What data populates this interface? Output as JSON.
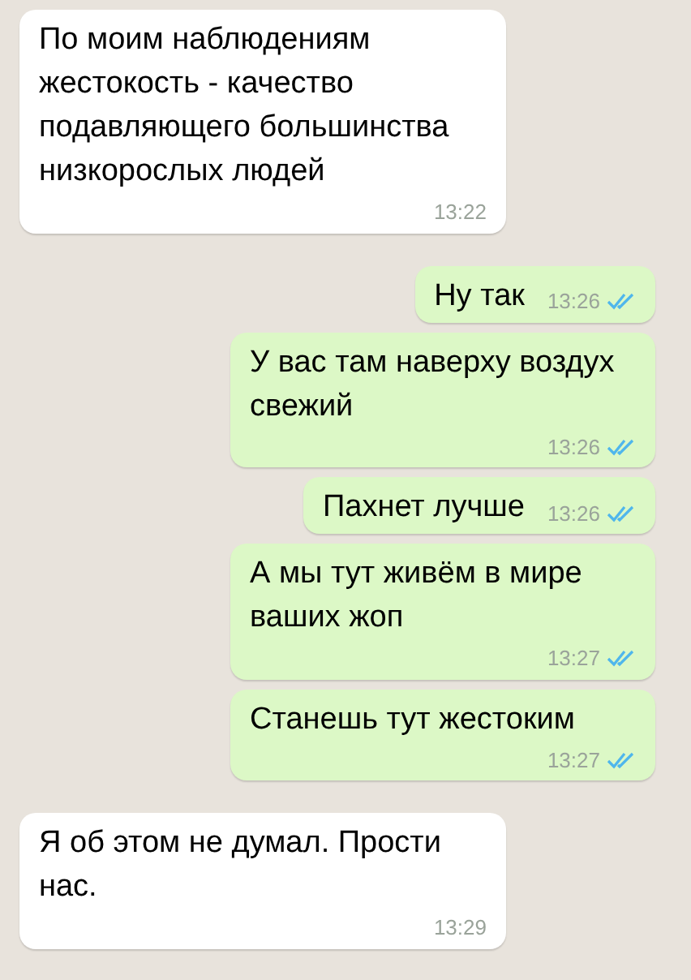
{
  "messages": [
    {
      "kind": "incoming",
      "text": "По моим наблюдениям жестокость - качество подавляющего большинства низкорослых людей",
      "time": "13:22"
    },
    {
      "kind": "outgoing",
      "text": "Ну так",
      "time": "13:26",
      "read": true
    },
    {
      "kind": "outgoing",
      "text": "У вас там наверху воздух свежий",
      "time": "13:26",
      "read": true
    },
    {
      "kind": "outgoing",
      "text": "Пахнет лучше",
      "time": "13:26",
      "read": true
    },
    {
      "kind": "outgoing",
      "text": "А мы тут живём в мире ваших жоп",
      "time": "13:27",
      "read": true
    },
    {
      "kind": "outgoing",
      "text": "Станешь тут жестоким",
      "time": "13:27",
      "read": true
    },
    {
      "kind": "incoming",
      "text": "Я об этом не думал. Прости нас.",
      "time": "13:29"
    }
  ]
}
